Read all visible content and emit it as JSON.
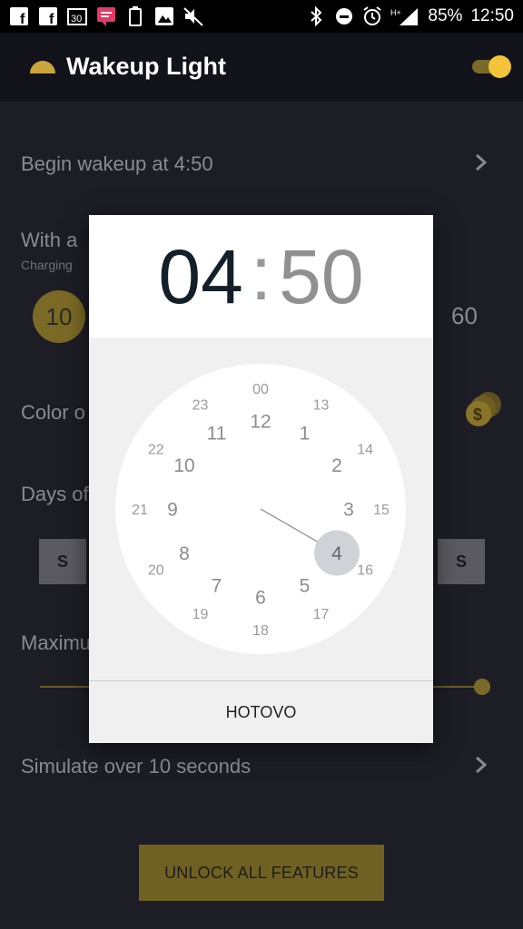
{
  "status_bar": {
    "battery_percent": "85%",
    "time": "12:50",
    "network": "H+",
    "icons": [
      "facebook-icon",
      "facebook-icon",
      "calendar-30-icon",
      "message-icon",
      "battery-icon",
      "image-icon",
      "mute-icon"
    ],
    "right_icons": [
      "bluetooth-icon",
      "do-not-disturb-icon",
      "alarm-icon",
      "signal-icon"
    ]
  },
  "app_bar": {
    "title": "Wakeup Light",
    "toggle_on": true
  },
  "background": {
    "begin_wakeup": "Begin wakeup at 4:50",
    "with_a_title": "With a",
    "charging_sub": "Charging",
    "circle_value": "10",
    "max_value": "60",
    "color_title": "Color o",
    "days_title": "Days of",
    "day_left": "S",
    "day_right": "S",
    "maximum_title": "Maximu",
    "simulate": "Simulate over 10 seconds",
    "unlock_button": "UNLOCK ALL FEATURES"
  },
  "time_picker": {
    "hours": "04",
    "separator": ":",
    "minutes": "50",
    "selected_hour": "4",
    "outer_ring": [
      "12",
      "1",
      "2",
      "3",
      "4",
      "5",
      "6",
      "7",
      "8",
      "9",
      "10",
      "11"
    ],
    "inner_ring": [
      "00",
      "13",
      "14",
      "15",
      "16",
      "17",
      "18",
      "19",
      "20",
      "21",
      "22",
      "23"
    ],
    "done_button": "HOTOVO"
  },
  "colors": {
    "accent_yellow": "#f3c43a",
    "dialog_bg": "#f0f0f0",
    "dim_gold": "#7b6a25"
  }
}
